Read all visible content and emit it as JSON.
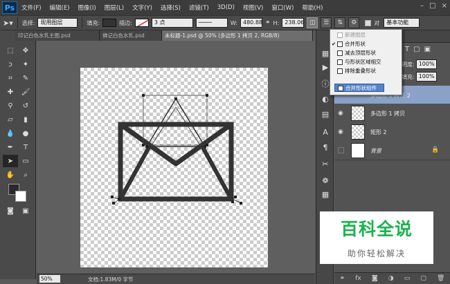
{
  "app": {
    "logo": "Ps"
  },
  "menubar": {
    "items": [
      "文件(F)",
      "编辑(E)",
      "图像(I)",
      "图层(L)",
      "文字(Y)",
      "选择(S)",
      "滤镜(T)",
      "3D(D)",
      "视图(V)",
      "窗口(W)",
      "帮助(H)"
    ],
    "window_controls": [
      "–",
      "□",
      "×"
    ]
  },
  "options": {
    "select_label": "选择:",
    "select_value": "现用图层",
    "fill_label": "填充:",
    "stroke_label": "描边:",
    "stroke_width": "3 点",
    "w_label": "W:",
    "w_value": "480.88",
    "h_label": "H:",
    "h_value": "238.06",
    "align_edges_label": "对",
    "workspace": "基本功能"
  },
  "tabs": [
    {
      "label": "印记白色水乳主图.psd"
    },
    {
      "label": "佛记白色水乳.psd"
    },
    {
      "label": "未标题-1.psd @ 50% (多边形 1 拷贝 2, RGB/8)"
    }
  ],
  "dropdown": {
    "items": [
      {
        "label": "新建图层",
        "state": "disabled",
        "checked": ""
      },
      {
        "label": "合并形状",
        "state": "normal",
        "checked": "✔"
      },
      {
        "label": "减去顶层形状",
        "state": "normal",
        "checked": ""
      },
      {
        "label": "与形状区域相交",
        "state": "normal",
        "checked": ""
      },
      {
        "label": "排除重叠形状",
        "state": "normal",
        "checked": ""
      },
      {
        "label": "合并形状组件",
        "state": "highlight",
        "checked": ""
      }
    ]
  },
  "layers_panel": {
    "opacity_label": "明度:",
    "opacity_value": "100%",
    "fill_label": "填充:",
    "fill_value": "100%",
    "layers": [
      {
        "name": "多边形 1 拷贝 2",
        "selected": true
      },
      {
        "name": "多边形 1 拷贝",
        "selected": false
      },
      {
        "name": "矩形 2",
        "selected": false
      },
      {
        "name": "背景",
        "selected": false
      }
    ]
  },
  "status": {
    "zoom": "50%",
    "doc_size": "文档:1.83M/0 字节"
  },
  "watermark": {
    "title": "百科全说",
    "subtitle": "助你轻松解决"
  },
  "colors": {
    "accent_highlight": "#5784c9",
    "layer_selected": "#8aa2c8",
    "watermark_green": "#1bb24f"
  }
}
